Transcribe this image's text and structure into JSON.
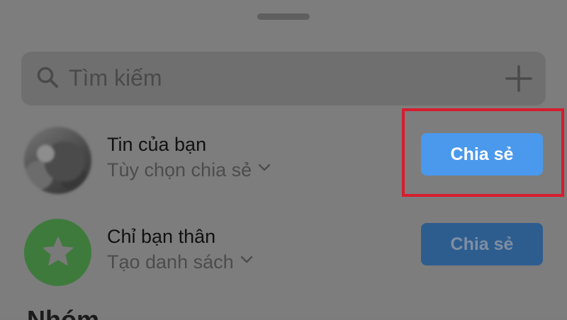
{
  "search": {
    "placeholder": "Tìm kiếm"
  },
  "rows": [
    {
      "title": "Tin của bạn",
      "subtitle": "Tùy chọn chia sẻ",
      "button_label": "Chia sẻ"
    },
    {
      "title": "Chỉ bạn thân",
      "subtitle": "Tạo danh sách",
      "button_label": "Chia sẻ"
    }
  ],
  "bottom_partial_text": "Nhóm",
  "icons": {
    "search": "search-icon",
    "add": "plus-icon",
    "chevron": "chevron-down-icon",
    "star": "star-icon"
  },
  "colors": {
    "overlay_gray": "#7d7d7d",
    "share_blue": "#4a99ec",
    "share_blue_dim": "#2d5d8f",
    "close_friends_green": "#3f7a3d",
    "highlight_red": "#d71c2f"
  }
}
